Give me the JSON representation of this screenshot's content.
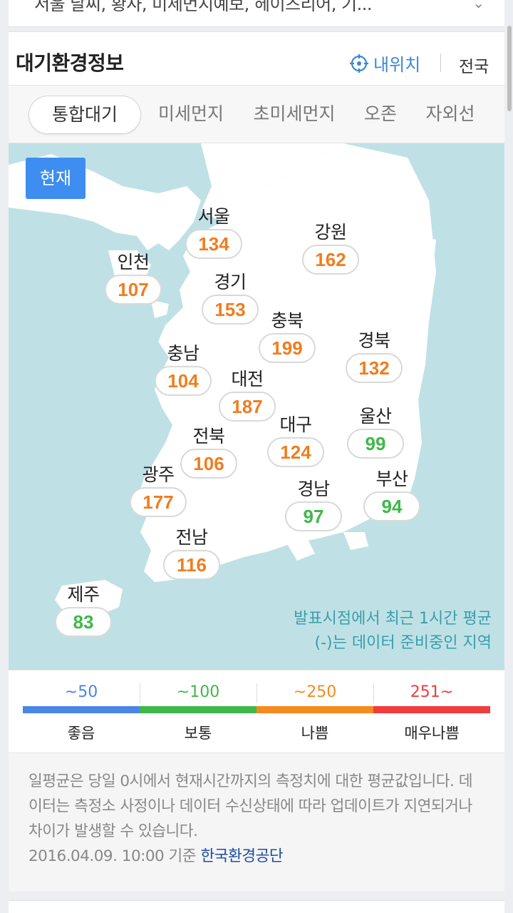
{
  "top_card": {
    "partial_text": "서울 날씨, 황사, 미세먼지예보, 헤이즈리어, 기..."
  },
  "header": {
    "title": "대기환경정보",
    "my_location": "내위치",
    "nationwide": "전국"
  },
  "tabs": [
    {
      "label": "통합대기",
      "active": true
    },
    {
      "label": "미세먼지",
      "active": false
    },
    {
      "label": "초미세먼지",
      "active": false
    },
    {
      "label": "오존",
      "active": false
    },
    {
      "label": "자외선",
      "active": false
    }
  ],
  "map": {
    "now_button": "현재",
    "regions": [
      {
        "name": "서울",
        "value": "134",
        "level": "bad"
      },
      {
        "name": "강원",
        "value": "162",
        "level": "bad"
      },
      {
        "name": "인천",
        "value": "107",
        "level": "bad"
      },
      {
        "name": "경기",
        "value": "153",
        "level": "bad"
      },
      {
        "name": "충북",
        "value": "199",
        "level": "bad"
      },
      {
        "name": "경북",
        "value": "132",
        "level": "bad"
      },
      {
        "name": "충남",
        "value": "104",
        "level": "bad"
      },
      {
        "name": "대전",
        "value": "187",
        "level": "bad"
      },
      {
        "name": "전북",
        "value": "106",
        "level": "bad"
      },
      {
        "name": "대구",
        "value": "124",
        "level": "bad"
      },
      {
        "name": "울산",
        "value": "99",
        "level": "normal"
      },
      {
        "name": "광주",
        "value": "177",
        "level": "bad"
      },
      {
        "name": "경남",
        "value": "97",
        "level": "normal"
      },
      {
        "name": "부산",
        "value": "94",
        "level": "normal"
      },
      {
        "name": "전남",
        "value": "116",
        "level": "bad"
      },
      {
        "name": "제주",
        "value": "83",
        "level": "normal"
      }
    ],
    "note_line1": "발표시점에서 최근 1시간 평균",
    "note_line2": "(-)는 데이터 준비중인 지역"
  },
  "legend": [
    {
      "range": "~50",
      "label": "좋음",
      "color": "#4a86e8"
    },
    {
      "range": "~100",
      "label": "보통",
      "color": "#3fb84a"
    },
    {
      "range": "~250",
      "label": "나쁨",
      "color": "#f58a1f"
    },
    {
      "range": "251~",
      "label": "매우나쁨",
      "color": "#f03c3c"
    }
  ],
  "footer_note": {
    "text": "일평균은 당일 0시에서 현재시간까지의 측정치에 대한 평균값입니다. 데이터는 측정소 사정이나 데이터 수신상태에 따라 업데이트가 지연되거나 차이가 발생할 수 있습니다.",
    "timestamp": "2016.04.09. 10:00 기준",
    "source": "한국환경공단"
  },
  "colors": {
    "bad": "#f07d1e",
    "normal": "#3fb84a",
    "accent": "#3a86d8",
    "sea": "#bfe1e6"
  }
}
